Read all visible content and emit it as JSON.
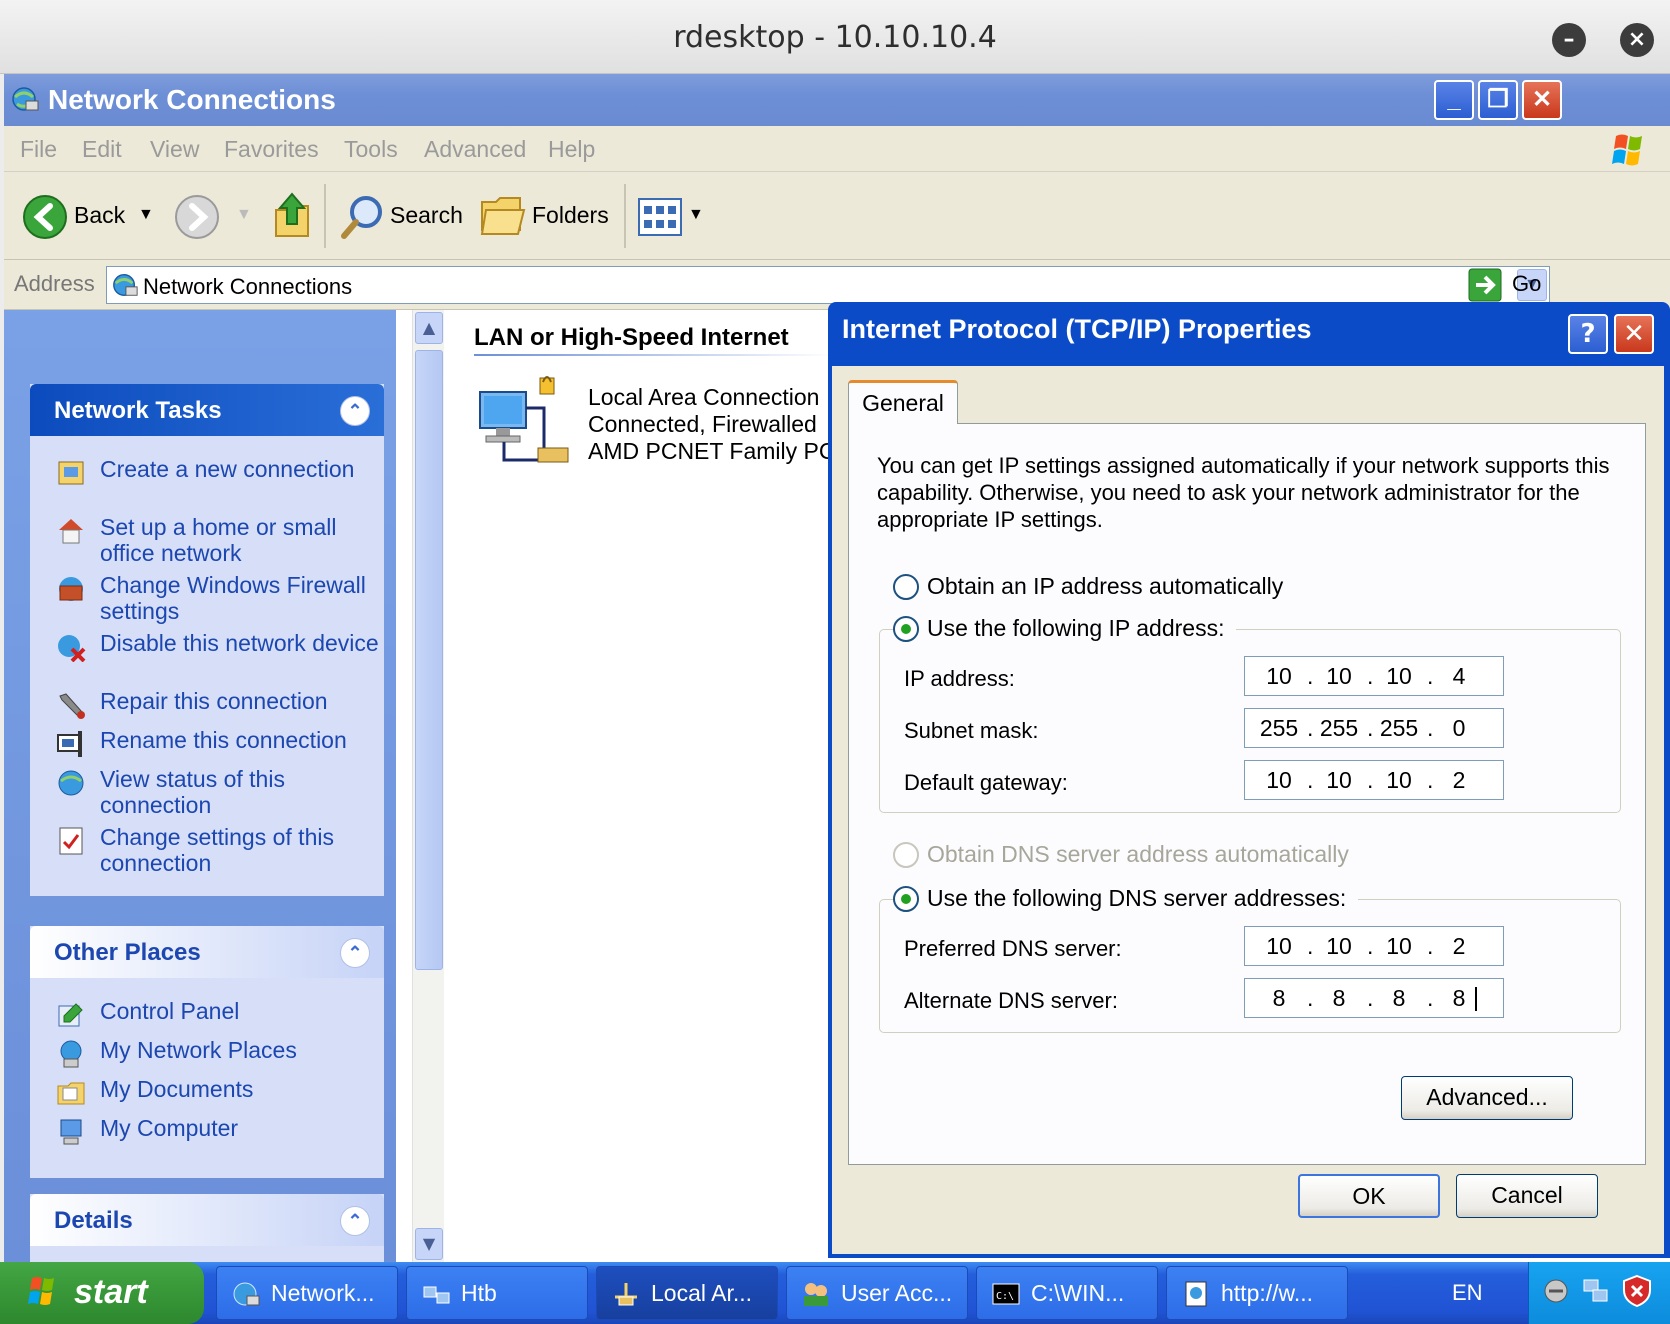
{
  "host": {
    "title": "rdesktop - 10.10.10.4"
  },
  "window": {
    "title": "Network Connections"
  },
  "menu": [
    "File",
    "Edit",
    "View",
    "Favorites",
    "Tools",
    "Advanced",
    "Help"
  ],
  "toolbar": {
    "back": "Back",
    "search": "Search",
    "folders": "Folders"
  },
  "address": {
    "label": "Address",
    "value": "Network Connections",
    "go": "Go"
  },
  "network_tasks": {
    "title": "Network Tasks",
    "items": [
      "Create a new connection",
      "Set up a home or small office network",
      "Change Windows Firewall settings",
      "Disable this network device",
      "Repair this connection",
      "Rename this connection",
      "View status of this connection",
      "Change settings of this connection"
    ]
  },
  "other_places": {
    "title": "Other Places",
    "items": [
      "Control Panel",
      "My Network Places",
      "My Documents",
      "My Computer"
    ]
  },
  "details": {
    "title": "Details"
  },
  "group": {
    "title": "LAN or High-Speed Internet"
  },
  "connection": {
    "name": "Local Area Connection",
    "status": "Connected, Firewalled",
    "device": "AMD PCNET Family PCI E"
  },
  "dialog": {
    "title": "Internet Protocol (TCP/IP) Properties",
    "help": "?",
    "tab": "General",
    "description": "You can get IP settings assigned automatically if your network supports this capability. Otherwise, you need to ask your network administrator for the appropriate IP settings.",
    "ip_auto": "Obtain an IP address automatically",
    "ip_manual": "Use the following IP address:",
    "ip_address_label": "IP address:",
    "ip_address": [
      "10",
      "10",
      "10",
      "4"
    ],
    "subnet_label": "Subnet mask:",
    "subnet": [
      "255",
      "255",
      "255",
      "0"
    ],
    "gateway_label": "Default gateway:",
    "gateway": [
      "10",
      "10",
      "10",
      "2"
    ],
    "dns_auto": "Obtain DNS server address automatically",
    "dns_manual": "Use the following DNS server addresses:",
    "preferred_dns_label": "Preferred DNS server:",
    "preferred_dns": [
      "10",
      "10",
      "10",
      "2"
    ],
    "alternate_dns_label": "Alternate DNS server:",
    "alternate_dns": [
      "8",
      "8",
      "8",
      "8"
    ],
    "advanced": "Advanced...",
    "ok": "OK",
    "cancel": "Cancel"
  },
  "taskbar": {
    "start": "start",
    "items": [
      "Network...",
      "Htb",
      "Local Ar...",
      "User Acc...",
      "C:\\WIN...",
      "http://w..."
    ],
    "language": "EN"
  },
  "colors": {
    "xp_blue": "#0b4bc7",
    "taskpane": "#6b8fd9",
    "dialog_face": "#ece9d8"
  }
}
